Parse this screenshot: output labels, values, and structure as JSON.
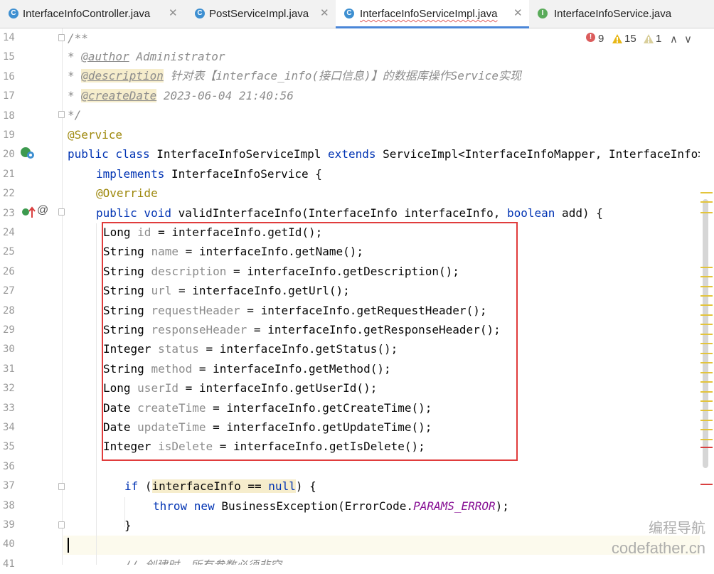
{
  "tabs": [
    {
      "label": "InterfaceInfoController.java",
      "icon": "C",
      "icon_color": "#3d8fd1",
      "active": false
    },
    {
      "label": "PostServiceImpl.java",
      "icon": "C",
      "icon_color": "#3d8fd1",
      "active": false
    },
    {
      "label": "InterfaceInfoServiceImpl.java",
      "icon": "C",
      "icon_color": "#3d8fd1",
      "active": true
    },
    {
      "label": "InterfaceInfoService.java",
      "icon": "I",
      "icon_color": "#5aab5a",
      "active": false
    }
  ],
  "tab_close_symbol": "✕",
  "inspections": {
    "errors": "9",
    "warnings": "15",
    "weak_warnings": "1",
    "up": "∧",
    "down": "∨"
  },
  "line_numbers": [
    "14",
    "15",
    "16",
    "17",
    "18",
    "19",
    "20",
    "21",
    "22",
    "23",
    "24",
    "25",
    "26",
    "27",
    "28",
    "29",
    "30",
    "31",
    "32",
    "33",
    "34",
    "35",
    "36",
    "37",
    "38",
    "39",
    "40",
    "41"
  ],
  "code": {
    "l14": "/**",
    "l15_star": "* ",
    "l15_tag": "@author",
    "l15_rest": " Administrator",
    "l16_star": "* ",
    "l16_tag": "@description",
    "l16_rest": " 针对表【interface_info(接口信息)】的数据库操作Service实现",
    "l17_star": "* ",
    "l17_tag": "@createDate",
    "l17_rest": " 2023-06-04 21:40:56",
    "l18": "*/",
    "l19": "@Service",
    "l20_kw": "public class",
    "l20_name": " InterfaceInfoServiceImpl ",
    "l20_ext": "extends",
    "l20_rest": " ServiceImpl<InterfaceInfoMapper, InterfaceInfo>",
    "l21_kw": "implements",
    "l21_rest": " InterfaceInfoService {",
    "l22": "@Override",
    "l23_kw": "public void",
    "l23_m": " validInterfaceInfo(InterfaceInfo interfaceInfo, ",
    "l23_kw2": "boolean",
    "l23_rest": " add) {",
    "fields": [
      {
        "type": "Long",
        "name": "id",
        "rhs": "interfaceInfo.getId();"
      },
      {
        "type": "String",
        "name": "name",
        "rhs": "interfaceInfo.getName();"
      },
      {
        "type": "String",
        "name": "description",
        "rhs": "interfaceInfo.getDescription();"
      },
      {
        "type": "String",
        "name": "url",
        "rhs": "interfaceInfo.getUrl();"
      },
      {
        "type": "String",
        "name": "requestHeader",
        "rhs": "interfaceInfo.getRequestHeader();"
      },
      {
        "type": "String",
        "name": "responseHeader",
        "rhs": "interfaceInfo.getResponseHeader();"
      },
      {
        "type": "Integer",
        "name": "status",
        "rhs": "interfaceInfo.getStatus();"
      },
      {
        "type": "String",
        "name": "method",
        "rhs": "interfaceInfo.getMethod();"
      },
      {
        "type": "Long",
        "name": "userId",
        "rhs": "interfaceInfo.getUserId();"
      },
      {
        "type": "Date",
        "name": "createTime",
        "rhs": "interfaceInfo.getCreateTime();"
      },
      {
        "type": "Date",
        "name": "updateTime",
        "rhs": "interfaceInfo.getUpdateTime();"
      },
      {
        "type": "Integer",
        "name": "isDelete",
        "rhs": "interfaceInfo.getIsDelete();"
      }
    ],
    "assign_op": " = ",
    "l37_kw": "if",
    "l37_open": " (",
    "l37_cond1": "interfaceInfo == ",
    "l37_null": "null",
    "l37_close": ") {",
    "l38_kw": "throw new",
    "l38_rest": " BusinessException(ErrorCode.",
    "l38_const": "PARAMS_ERROR",
    "l38_end": ");",
    "l39": "}",
    "l41": "// 创建时，所有参数必须非空"
  },
  "watermark": {
    "line1": "编程导航",
    "line2": "codefather.cn"
  }
}
